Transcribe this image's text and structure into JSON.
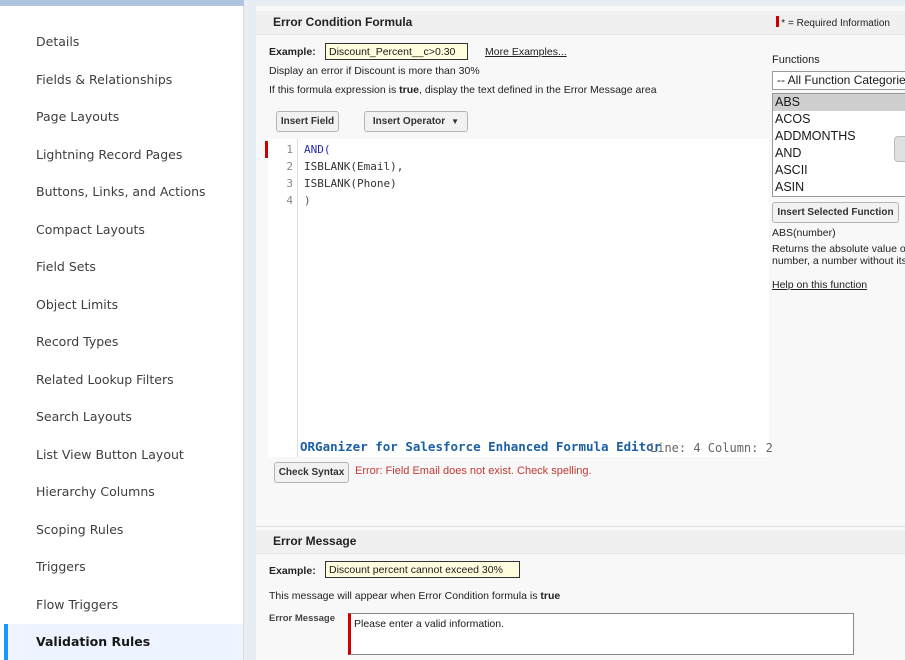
{
  "sidebar": {
    "items": [
      {
        "label": "Details"
      },
      {
        "label": "Fields & Relationships"
      },
      {
        "label": "Page Layouts"
      },
      {
        "label": "Lightning Record Pages"
      },
      {
        "label": "Buttons, Links, and Actions"
      },
      {
        "label": "Compact Layouts"
      },
      {
        "label": "Field Sets"
      },
      {
        "label": "Object Limits"
      },
      {
        "label": "Record Types"
      },
      {
        "label": "Related Lookup Filters"
      },
      {
        "label": "Search Layouts"
      },
      {
        "label": "List View Button Layout"
      },
      {
        "label": "Hierarchy Columns"
      },
      {
        "label": "Scoping Rules"
      },
      {
        "label": "Triggers"
      },
      {
        "label": "Flow Triggers"
      },
      {
        "label": "Validation Rules"
      }
    ],
    "active_index": 16
  },
  "formula_section": {
    "title": "Error Condition Formula",
    "required_info": "= Required Information",
    "required_marker": "*",
    "example_label": "Example:",
    "example_value": "Discount_Percent__c>0.30",
    "more_examples": "More Examples...",
    "example_desc": "Display an error if Discount is more than 30%",
    "instruction_pre": "If this formula expression is ",
    "instruction_bold": "true",
    "instruction_post": ", display the text defined in the Error Message area",
    "insert_field": "Insert Field",
    "insert_operator": "Insert Operator",
    "code_lines": [
      {
        "num": "1",
        "text": "AND("
      },
      {
        "num": "2",
        "text": "ISBLANK(Email),"
      },
      {
        "num": "3",
        "text": "ISBLANK(Phone)"
      },
      {
        "num": "4",
        "text": ")"
      }
    ],
    "editor_footer": "ORGanizer for Salesforce Enhanced Formula Editor",
    "cursor_position": "Line: 4 Column: 2",
    "check_syntax": "Check Syntax",
    "syntax_error": "Error: Field Email does not exist. Check spelling."
  },
  "functions": {
    "label": "Functions",
    "category_selected": "-- All Function Categories --",
    "items": [
      "ABS",
      "ACOS",
      "ADDMONTHS",
      "AND",
      "ASCII",
      "ASIN"
    ],
    "selected": "ABS",
    "insert_button": "Insert Selected Function",
    "signature": "ABS(number)",
    "description_line1": "Returns the absolute value of a",
    "description_line2": "number, a number without its sign",
    "help_link": "Help on this function"
  },
  "error_message_section": {
    "title": "Error Message",
    "example_label": "Example:",
    "example_value": "Discount percent cannot exceed 30%",
    "note_pre": "This message will appear when Error Condition formula is ",
    "note_bold": "true",
    "field_label": "Error Message",
    "field_value": "Please enter a valid information."
  },
  "colors": {
    "accent": "#1b96ff",
    "error": "#c23934",
    "required": "#cc0000",
    "editor_footer": "#1b5fa5"
  }
}
